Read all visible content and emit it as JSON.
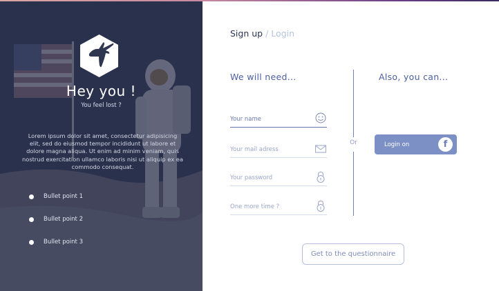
{
  "hero": {
    "title": "Hey you !",
    "subtitle": "You feel lost ?",
    "body": "Lorem ipsum dolor sit amet, consectetur adipisicing elit, sed do eiusmod tempor incididunt ut labore et dolore magna aliqua. Ut enim ad minim veniam, quis nostrud exercitation ullamco laboris nisi ut aliquip ex ea commodo consequat.",
    "bullets": [
      "Bullet point 1",
      "Bullet point 2",
      "Bullet point 3"
    ],
    "logo_icon": "antelope-hexagon-logo"
  },
  "tabs": {
    "signup": "Sign up",
    "separator": "/",
    "login": "Login"
  },
  "form": {
    "heading": "We will need...",
    "fields": [
      {
        "placeholder": "Your name",
        "icon": "smiley-icon"
      },
      {
        "placeholder": "Your mail adress",
        "icon": "envelope-icon"
      },
      {
        "placeholder": "Your password",
        "icon": "lock-icon"
      },
      {
        "placeholder": "One more time ?",
        "icon": "lock-icon"
      }
    ]
  },
  "or_label": "Or",
  "social": {
    "heading": "Also, you can...",
    "facebook_label": "Login on",
    "facebook_icon": "facebook-icon"
  },
  "cta": {
    "label": "Get to the questionnaire"
  },
  "colors": {
    "accent": "#4c5fa0",
    "panel": "#2f3650",
    "facebook_button": "#7c90c6"
  }
}
